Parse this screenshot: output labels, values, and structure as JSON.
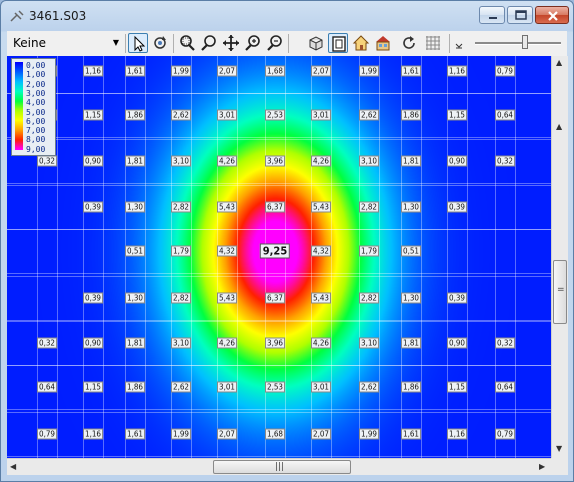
{
  "window": {
    "title": "3461.S03"
  },
  "toolbar": {
    "layer_select": "Keine Arbeitseben",
    "tools": [
      "select-arrow-icon",
      "rotate-view-icon",
      "zoom-window-icon",
      "zoom-in-icon",
      "pan-icon",
      "zoom-realtime-icon",
      "zoom-out-icon",
      "wireframe-3d-icon",
      "frame-view-icon",
      "room-view-icon",
      "building-view-icon",
      "redraw-icon",
      "grid-icon"
    ]
  },
  "legend": {
    "levels": [
      "0,00",
      "1,00",
      "2,00",
      "3,00",
      "4,00",
      "5,00",
      "6,00",
      "7,00",
      "8,00",
      "9,00"
    ],
    "colors": [
      "#0000ff",
      "#0060ff",
      "#00c0ff",
      "#00ffc0",
      "#00ff40",
      "#b0ff00",
      "#ffff00",
      "#ffa000",
      "#ff2000",
      "#ff00ff"
    ]
  },
  "grid": {
    "rows": [
      [
        "0,79",
        "1,16",
        "1,61",
        "1,99",
        "2,07",
        "1,68",
        "2,07",
        "1,99",
        "1,61",
        "1,16",
        "0,79"
      ],
      [
        "0,64",
        "1,15",
        "1,86",
        "2,62",
        "3,01",
        "2,53",
        "3,01",
        "2,62",
        "1,86",
        "1,15",
        "0,64"
      ],
      [
        "0,32",
        "0,90",
        "1,81",
        "3,10",
        "4,26",
        "3,96",
        "4,26",
        "3,10",
        "1,81",
        "0,90",
        "0,32"
      ],
      [
        "",
        "0,39",
        "1,30",
        "2,82",
        "5,43",
        "6,37",
        "5,43",
        "2,82",
        "1,30",
        "0,39",
        ""
      ],
      [
        "",
        "",
        "0,51",
        "1,79",
        "4,32",
        "9,25",
        "4,32",
        "1,79",
        "0,51",
        "",
        ""
      ],
      [
        "",
        "0,39",
        "1,30",
        "2,82",
        "5,43",
        "6,37",
        "5,43",
        "2,82",
        "1,30",
        "0,39",
        ""
      ],
      [
        "0,32",
        "0,90",
        "1,81",
        "3,10",
        "4,26",
        "3,96",
        "4,26",
        "3,10",
        "1,81",
        "0,90",
        "0,32"
      ],
      [
        "0,64",
        "1,15",
        "1,86",
        "2,62",
        "3,01",
        "2,53",
        "3,01",
        "2,62",
        "1,86",
        "1,15",
        "0,64"
      ],
      [
        "0,79",
        "1,16",
        "1,61",
        "1,99",
        "2,07",
        "1,68",
        "2,07",
        "1,99",
        "1,61",
        "1,16",
        "0,79"
      ]
    ],
    "peak_value": "9,25"
  },
  "scrollbars": {
    "h_grip": "|||",
    "v_grip": "="
  }
}
